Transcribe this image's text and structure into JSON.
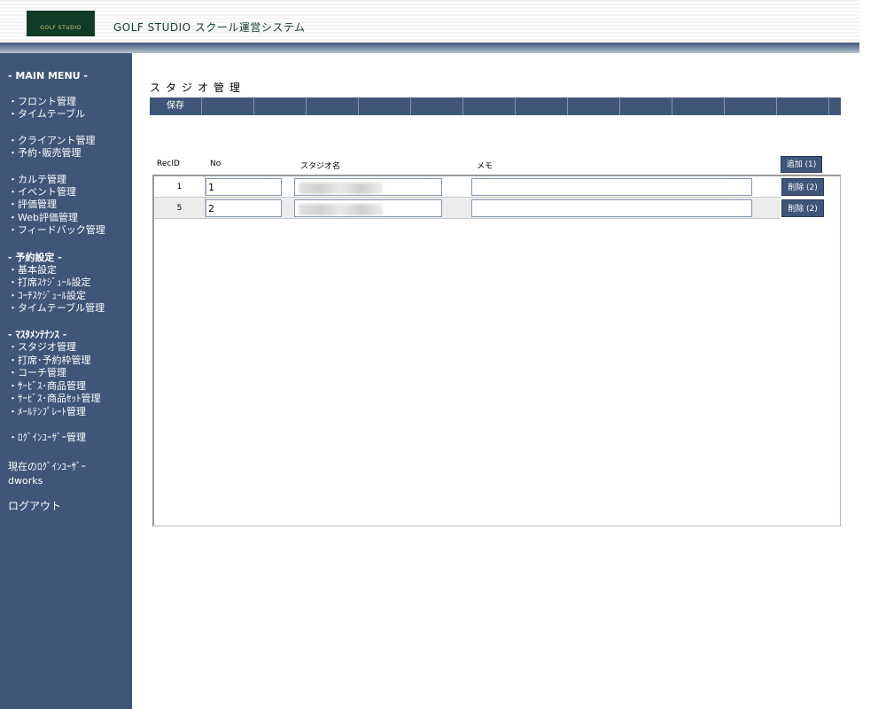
{
  "header": {
    "logo_text": "GOLF STUDIO",
    "app_title": "GOLF STUDIO スクール運営システム"
  },
  "sidebar": {
    "main_menu": "- MAIN MENU -",
    "front": "・フロント管理",
    "timetable": "・タイムテーブル",
    "client": "・クライアント管理",
    "reserve_sales": "・予約･販売管理",
    "karte": "・カルテ管理",
    "event": "・イベント管理",
    "evaluation": "・評価管理",
    "web_evaluation": "・Web評価管理",
    "feedback": "・フィードバック管理",
    "reserve_settings": "- 予約設定 -",
    "basic_settings": "・基本設定",
    "seat_schedule": "・打席ｽｹｼﾞｭｰﾙ設定",
    "coach_schedule": "・ｺｰﾁｽｹｼﾞｭｰﾙ設定",
    "timetable_manage": "・タイムテーブル管理",
    "master_maintenance": "- ﾏｽﾀﾒﾝﾃﾅﾝｽ -",
    "studio_manage": "・スタジオ管理",
    "seat_frame": "・打席･予約枠管理",
    "coach_manage": "・コーチ管理",
    "service_product": "・ｻｰﾋﾞｽ･商品管理",
    "service_set": "・ｻｰﾋﾞｽ･商品ｾｯﾄ管理",
    "mail_template": "・ﾒｰﾙﾃﾝﾌﾟﾚｰﾄ管理",
    "login_user_manage": "・ﾛｸﾞｲﾝﾕｰｻﾞｰ管理",
    "current_user_label": "現在のﾛｸﾞｲﾝﾕｰｻﾞｰ",
    "current_user": "dworks",
    "logout": "ログアウト"
  },
  "main": {
    "heading": "スタジオ管理",
    "toolbar": {
      "save": "保存"
    },
    "columns": {
      "recid": "RecID",
      "no": "No",
      "studio_name": "スタジオ名",
      "memo": "メモ"
    },
    "add_button": "追加 (1)",
    "rows": [
      {
        "recid": "1",
        "no": "1",
        "memo": "",
        "delete_label": "削除 (2)"
      },
      {
        "recid": "5",
        "no": "2",
        "memo": "",
        "delete_label": "削除 (2)"
      }
    ]
  },
  "colors": {
    "nav": "#3f5678",
    "logo_bg": "#0f3b27"
  }
}
